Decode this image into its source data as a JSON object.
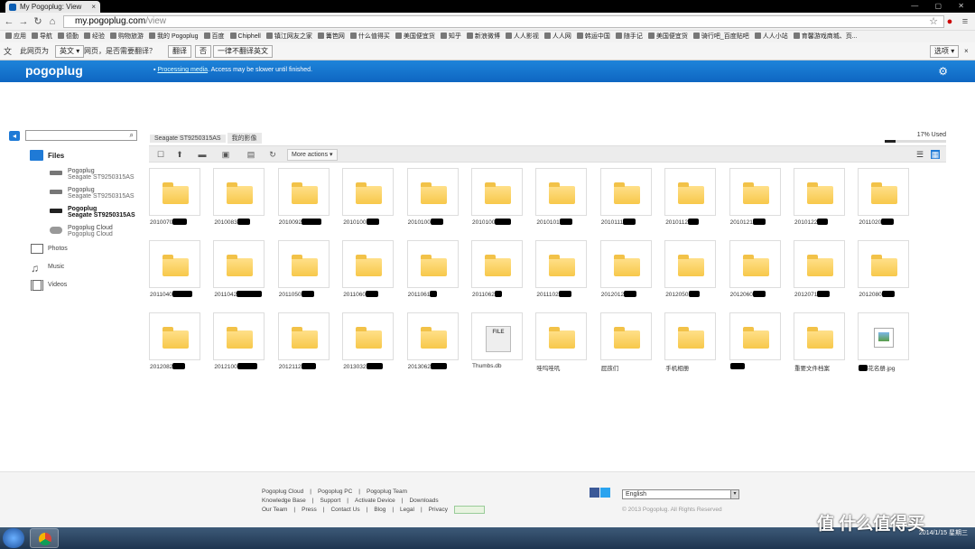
{
  "browser": {
    "tab_title": "My Pogoplug: View",
    "url_host": "my.pogoplug.com",
    "url_path": "/view",
    "bookmarks": [
      "应用",
      "导航",
      "德勤",
      "经验",
      "购物旅游",
      "我的 Pogoplug",
      "百度",
      "Chiphell",
      "镇江网友之家",
      "篝笆网",
      "什么值得买",
      "美国便宜货",
      "知乎",
      "新浪微博",
      "人人影视",
      "人人网",
      "韩运中国",
      "随手记",
      "美国便宜货",
      "骑行吧_百度贴吧",
      "人人小站",
      "育馨游戏商城、页..."
    ],
    "translate": {
      "prefix": "此网页为",
      "lang": "英文",
      "question": "网页，是否需要翻译？",
      "translate_btn": "翻译",
      "no_btn": "否",
      "never_btn": "一律不翻译英文",
      "options_btn": "选项"
    }
  },
  "header": {
    "logo": "pogoplug",
    "processing_link": "Processing media",
    "processing_text": ". Access may be slower until finished."
  },
  "sidebar": {
    "files": "Files",
    "devices": [
      {
        "name": "Pogoplug",
        "sub": "Seagate ST9250315AS"
      },
      {
        "name": "Pogoplug",
        "sub": "Seagate ST9250315AS"
      },
      {
        "name": "Pogoplug",
        "sub": "Seagate ST9250315AS"
      },
      {
        "name": "Pogoplug Cloud",
        "sub": "Pogoplug Cloud"
      }
    ],
    "photos": "Photos",
    "music": "Music",
    "videos": "Videos"
  },
  "breadcrumb": [
    "Seagate ST9250315AS",
    "我的影像"
  ],
  "usage": {
    "label": "17% Used",
    "fraction": 0.17
  },
  "toolbar": {
    "more_actions": "More actions"
  },
  "files": [
    {
      "label": "2010070",
      "type": "folder"
    },
    {
      "label": "2010083",
      "type": "folder"
    },
    {
      "label": "2010092",
      "type": "folder"
    },
    {
      "label": "2010100",
      "type": "folder"
    },
    {
      "label": "2010100",
      "type": "folder"
    },
    {
      "label": "2010100",
      "type": "folder"
    },
    {
      "label": "2010101",
      "type": "folder"
    },
    {
      "label": "2010111",
      "type": "folder"
    },
    {
      "label": "2010112",
      "type": "folder"
    },
    {
      "label": "2010121",
      "type": "folder"
    },
    {
      "label": "2010122",
      "type": "folder"
    },
    {
      "label": "2011020",
      "type": "folder"
    },
    {
      "label": "2011040",
      "type": "folder"
    },
    {
      "label": "2011042",
      "type": "folder"
    },
    {
      "label": "2011050",
      "type": "folder"
    },
    {
      "label": "2011060",
      "type": "folder"
    },
    {
      "label": "2011061",
      "type": "folder"
    },
    {
      "label": "2011062",
      "type": "folder"
    },
    {
      "label": "2011102",
      "type": "folder"
    },
    {
      "label": "2012012",
      "type": "folder"
    },
    {
      "label": "2012050",
      "type": "folder"
    },
    {
      "label": "2012060",
      "type": "folder"
    },
    {
      "label": "2012071",
      "type": "folder"
    },
    {
      "label": "2012080",
      "type": "folder"
    },
    {
      "label": "2012082",
      "type": "folder"
    },
    {
      "label": "2012100",
      "type": "folder"
    },
    {
      "label": "2012112",
      "type": "folder"
    },
    {
      "label": "2013032",
      "type": "folder"
    },
    {
      "label": "2013062",
      "type": "folder"
    },
    {
      "label": "Thumbs.db",
      "type": "file"
    },
    {
      "label": "哇呜哇叽",
      "type": "folder"
    },
    {
      "label": "屁孩们",
      "type": "folder"
    },
    {
      "label": "手机相册",
      "type": "folder"
    },
    {
      "label": "",
      "type": "folder"
    },
    {
      "label": "重要文件档案",
      "type": "folder"
    },
    {
      "label": "花名册.jpg",
      "type": "image"
    }
  ],
  "footer": {
    "row1": [
      "Pogoplug Cloud",
      "|",
      "Pogoplug PC",
      "|",
      "Pogoplug Team"
    ],
    "row2": [
      "Knowledge Base",
      "|",
      "Support",
      "|",
      "Activate Device",
      "|",
      "Downloads"
    ],
    "row3": [
      "Our Team",
      "|",
      "Press",
      "|",
      "Contact Us",
      "|",
      "Blog",
      "|",
      "Legal",
      "|",
      "Privacy",
      "|"
    ],
    "language": "English",
    "copyright": "© 2013 Pogoplug. All Rights Reserved"
  },
  "taskbar": {
    "date": "2014/1/15 星期三"
  },
  "watermark": "值 什么值得买",
  "colors": {
    "brand_blue": "#1e84da",
    "folder_yellow": "#f7c84a"
  }
}
